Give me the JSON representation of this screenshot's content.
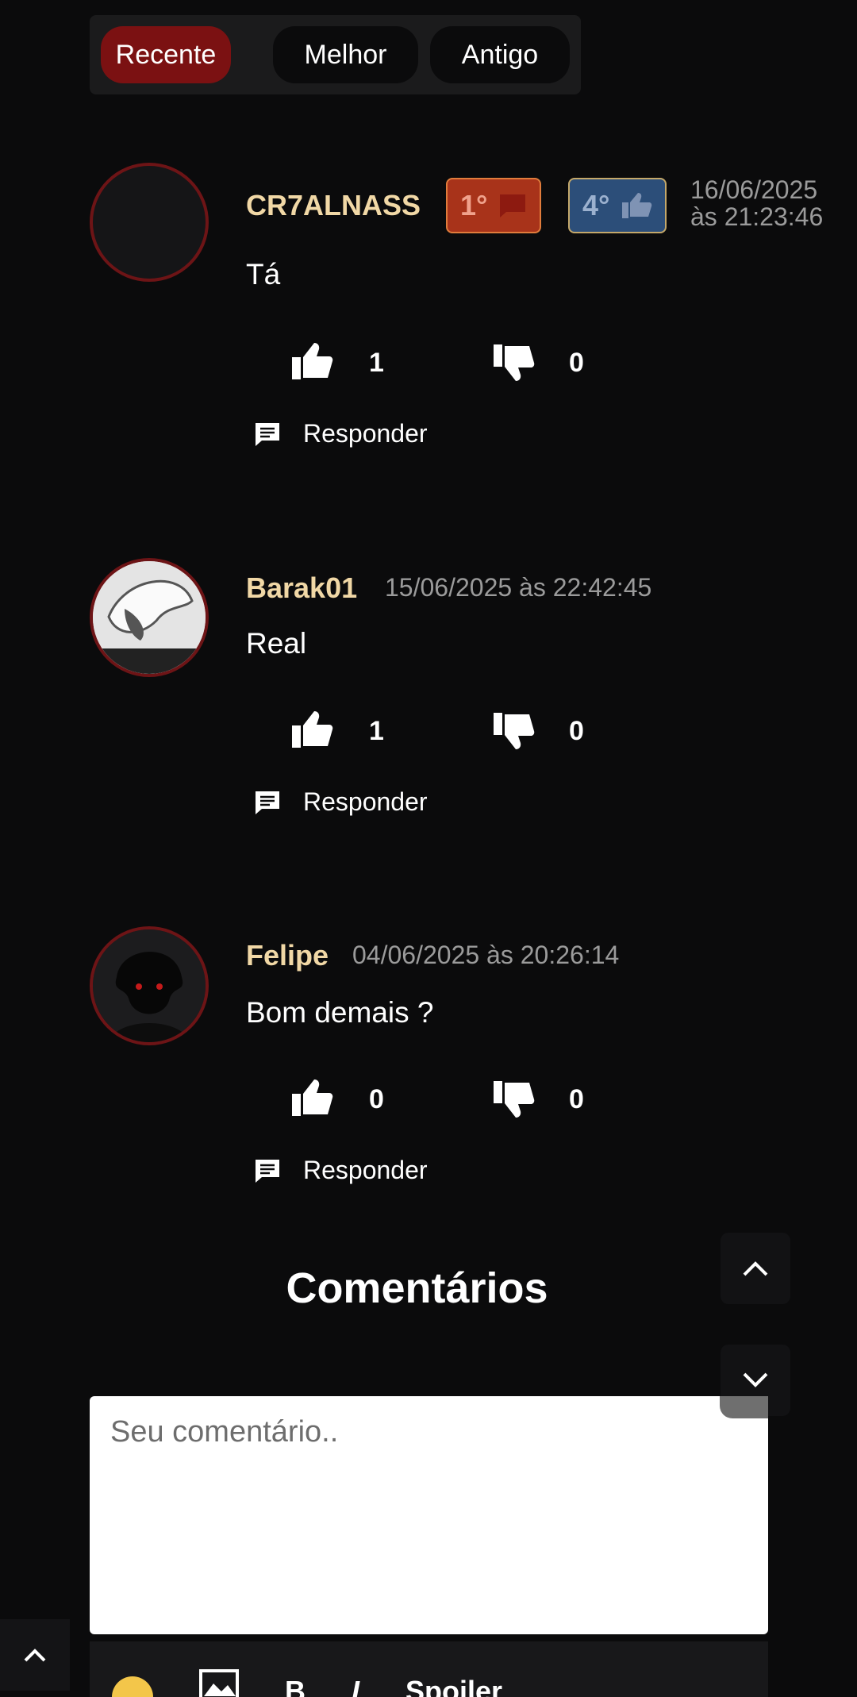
{
  "sort": {
    "recent": "Recente",
    "best": "Melhor",
    "oldest": "Antigo"
  },
  "comments": [
    {
      "user": "CR7ALNASS",
      "date_line1": "16/06/2025",
      "date_line2": "às 21:23:46",
      "badge1": "1°",
      "badge2": "4°",
      "text": "Tá",
      "likes": "1",
      "dislikes": "0",
      "reply": "Responder"
    },
    {
      "user": "Barak01",
      "date": "15/06/2025 às 22:42:45",
      "text": "Real",
      "likes": "1",
      "dislikes": "0",
      "reply": "Responder"
    },
    {
      "user": "Felipe",
      "date": "04/06/2025 às 20:26:14",
      "text": "Bom demais ?",
      "likes": "0",
      "dislikes": "0",
      "reply": "Responder"
    }
  ],
  "section_title": "Comentários",
  "input": {
    "placeholder": "Seu comentário.."
  },
  "toolbar": {
    "bold": "B",
    "italic": "I",
    "spoiler": "Spoiler"
  },
  "colors": {
    "accent": "#7b1112",
    "username": "#f1d8a6",
    "avatar_border": "#6d1416"
  }
}
